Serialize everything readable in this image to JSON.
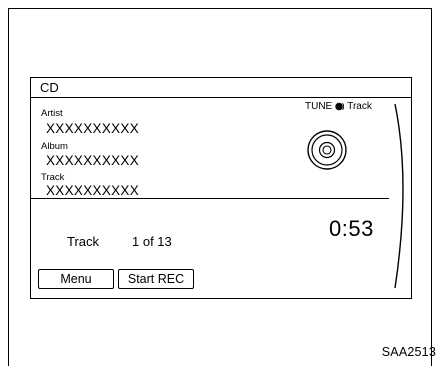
{
  "screen": {
    "title": "CD",
    "artist_label": "Artist",
    "artist_value": "XXXXXXXXXX",
    "album_label": "Album",
    "album_value": "XXXXXXXXXX",
    "track_label": "Track",
    "track_value": "XXXXXXXXXX",
    "tune_text": "TUNE",
    "tune_suffix": "Track",
    "tune_icon": "tune-knob-icon",
    "disc_icon": "cd-disc-icon",
    "track_heading": "Track",
    "track_count": "1 of 13",
    "elapsed_time": "0:53"
  },
  "buttons": {
    "menu_label": "Menu",
    "start_rec_label": "Start REC"
  },
  "figure": {
    "caption": "SAA2513"
  }
}
